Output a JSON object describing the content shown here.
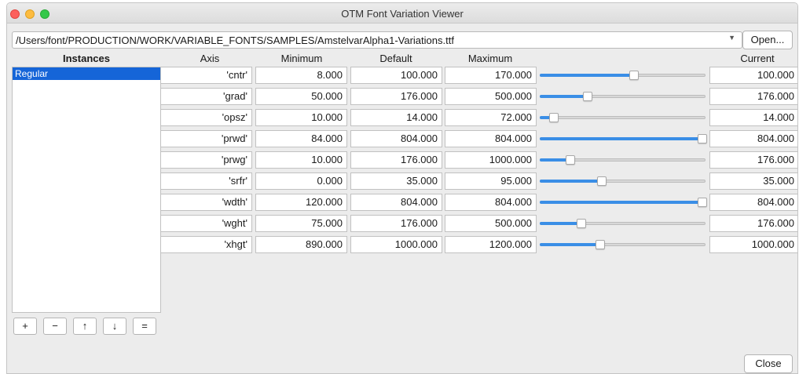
{
  "window": {
    "title": "OTM Font Variation Viewer"
  },
  "file": {
    "path": "/Users/font/PRODUCTION/WORK/VARIABLE_FONTS/SAMPLES/AmstelvarAlpha1-Variations.ttf",
    "open_label": "Open..."
  },
  "instances": {
    "header": "Instances",
    "items": [
      "Regular"
    ],
    "buttons": [
      "+",
      "−",
      "↑",
      "↓",
      "="
    ]
  },
  "columns": {
    "axis": "Axis",
    "minimum": "Minimum",
    "default": "Default",
    "maximum": "Maximum",
    "current": "Current"
  },
  "axes": [
    {
      "tag": "'cntr'",
      "min": "8.000",
      "default": "100.000",
      "max": "170.000",
      "current": "100.000",
      "slider_fraction": 0.57
    },
    {
      "tag": "'grad'",
      "min": "50.000",
      "default": "176.000",
      "max": "500.000",
      "current": "176.000",
      "slider_fraction": 0.28
    },
    {
      "tag": "'opsz'",
      "min": "10.000",
      "default": "14.000",
      "max": "72.000",
      "current": "14.000",
      "slider_fraction": 0.07
    },
    {
      "tag": "'prwd'",
      "min": "84.000",
      "default": "804.000",
      "max": "804.000",
      "current": "804.000",
      "slider_fraction": 1.0
    },
    {
      "tag": "'prwg'",
      "min": "10.000",
      "default": "176.000",
      "max": "1000.000",
      "current": "176.000",
      "slider_fraction": 0.17
    },
    {
      "tag": "'srfr'",
      "min": "0.000",
      "default": "35.000",
      "max": "95.000",
      "current": "35.000",
      "slider_fraction": 0.37
    },
    {
      "tag": "'wdth'",
      "min": "120.000",
      "default": "804.000",
      "max": "804.000",
      "current": "804.000",
      "slider_fraction": 1.0
    },
    {
      "tag": "'wght'",
      "min": "75.000",
      "default": "176.000",
      "max": "500.000",
      "current": "176.000",
      "slider_fraction": 0.24
    },
    {
      "tag": "'xhgt'",
      "min": "890.000",
      "default": "1000.000",
      "max": "1200.000",
      "current": "1000.000",
      "slider_fraction": 0.36
    }
  ],
  "footer": {
    "close_label": "Close"
  },
  "colors": {
    "accent": "#3a8ee6",
    "selection": "#1565d8"
  }
}
